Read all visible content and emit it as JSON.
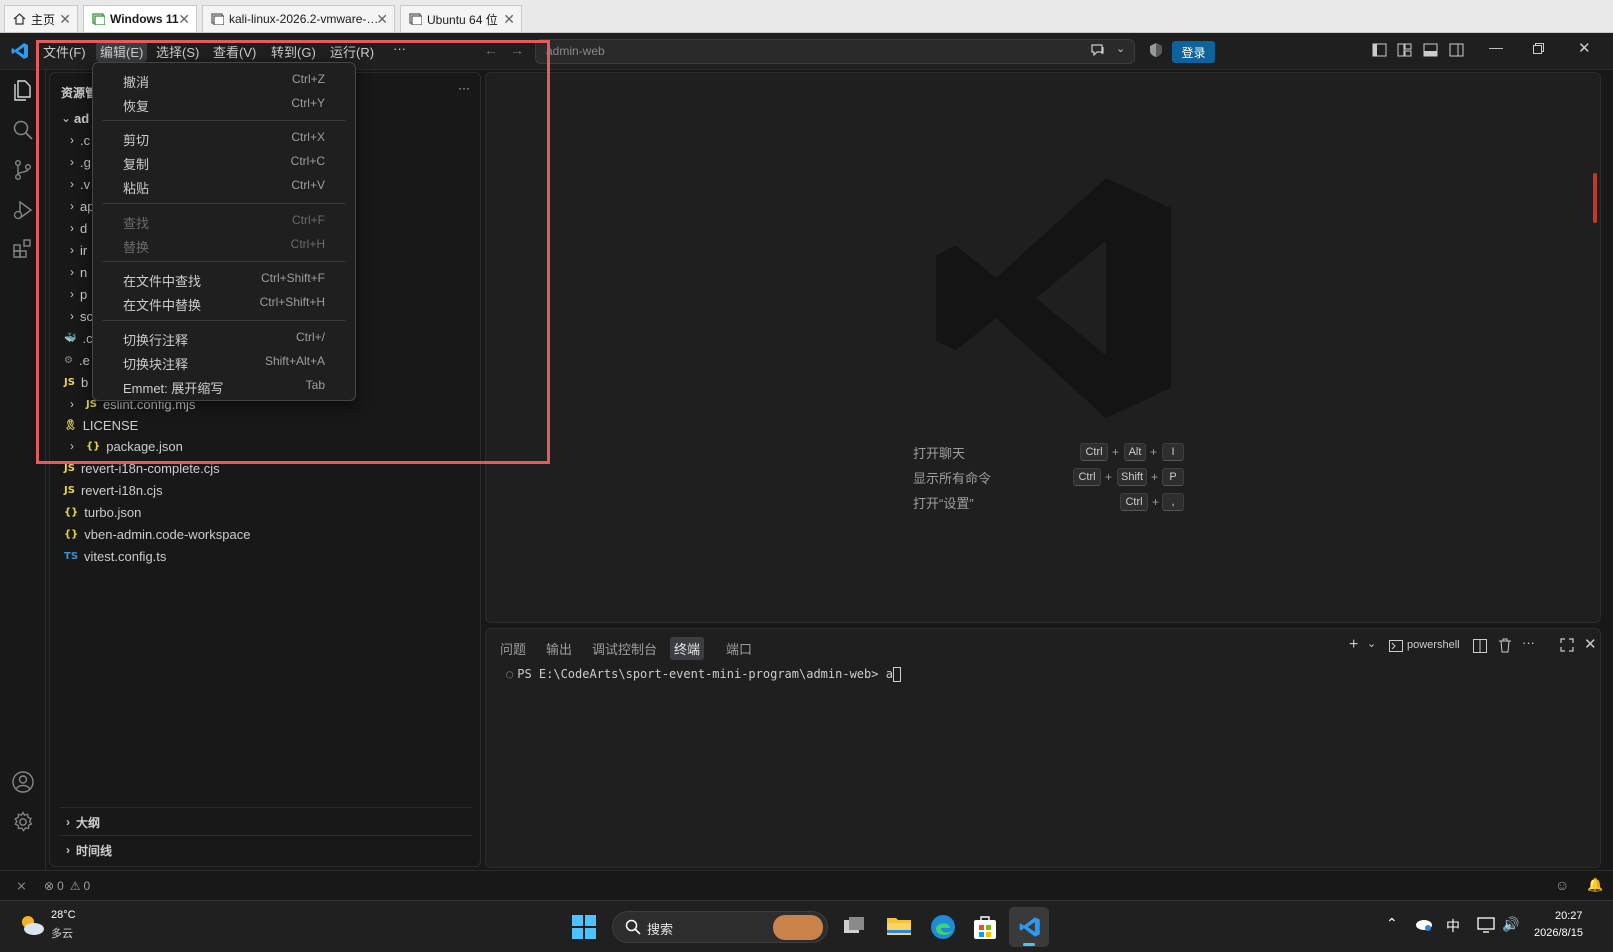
{
  "vm_tabs": [
    {
      "label": "主页",
      "icon": "home-icon"
    },
    {
      "label": "Windows 11",
      "icon": "vm-icon",
      "active": true
    },
    {
      "label": "kali-linux-2026.2-vmware-am...",
      "icon": "vm-icon"
    },
    {
      "label": "Ubuntu 64 位",
      "icon": "vm-icon"
    }
  ],
  "menubar": {
    "items": [
      "文件(F)",
      "编辑(E)",
      "选择(S)",
      "查看(V)",
      "转到(G)",
      "运行(R)",
      "···"
    ],
    "active": "编辑(E)"
  },
  "titlebar": {
    "search_text": "admin-web",
    "login_label": "登录"
  },
  "edit_menu": {
    "items": [
      {
        "label": "撤消",
        "shortcut": "Ctrl+Z"
      },
      {
        "label": "恢复",
        "shortcut": "Ctrl+Y"
      },
      {
        "label": "剪切",
        "shortcut": "Ctrl+X"
      },
      {
        "label": "复制",
        "shortcut": "Ctrl+C"
      },
      {
        "label": "粘贴",
        "shortcut": "Ctrl+V"
      },
      {
        "label": "查找",
        "shortcut": "Ctrl+F",
        "disabled": true
      },
      {
        "label": "替换",
        "shortcut": "Ctrl+H",
        "disabled": true
      },
      {
        "label": "在文件中查找",
        "shortcut": "Ctrl+Shift+F"
      },
      {
        "label": "在文件中替换",
        "shortcut": "Ctrl+Shift+H"
      },
      {
        "label": "切换行注释",
        "shortcut": "Ctrl+/"
      },
      {
        "label": "切换块注释",
        "shortcut": "Shift+Alt+A"
      },
      {
        "label": "Emmet: 展开缩写",
        "shortcut": "Tab"
      }
    ]
  },
  "explorer": {
    "title": "资源管",
    "more": "···",
    "root": "ad",
    "partial_rows": [
      ".c",
      ".g",
      ".v",
      "ap",
      "d",
      "ir",
      "n",
      "p",
      "sc",
      ".c",
      ".e",
      "b"
    ],
    "files": [
      {
        "name": "eslint.config.mjs",
        "icon": "JS",
        "folder": true
      },
      {
        "name": "LICENSE",
        "icon": "license"
      },
      {
        "name": "package.json",
        "icon": "{}",
        "folder": true
      },
      {
        "name": "revert-i18n-complete.cjs",
        "icon": "JS"
      },
      {
        "name": "revert-i18n.cjs",
        "icon": "JS"
      },
      {
        "name": "turbo.json",
        "icon": "{}"
      },
      {
        "name": "vben-admin.code-workspace",
        "icon": "{}"
      },
      {
        "name": "vitest.config.ts",
        "icon": "TS"
      }
    ],
    "outline_label": "大纲",
    "timeline_label": "时间线"
  },
  "welcome": {
    "shortcuts": [
      {
        "label": "打开聊天",
        "keys": [
          "Ctrl",
          "Alt",
          "I"
        ]
      },
      {
        "label": "显示所有命令",
        "keys": [
          "Ctrl",
          "Shift",
          "P"
        ]
      },
      {
        "label": "打开“设置”",
        "keys": [
          "Ctrl",
          ","
        ]
      }
    ]
  },
  "panel": {
    "tabs": [
      "问题",
      "输出",
      "调试控制台",
      "终端",
      "端口"
    ],
    "active_tab": "终端",
    "shell": "powershell",
    "prompt": "PS E:\\CodeArts\\sport-event-mini-program\\admin-web> ",
    "input": "a"
  },
  "statusbar": {
    "errors": "0",
    "warnings": "0"
  },
  "taskbar": {
    "weather_temp": "28°C",
    "weather_desc": "多云",
    "search_label": "搜索",
    "ime": "中",
    "time": "20:27",
    "date": "2026/8/15"
  },
  "colors": {
    "accent": "#0e639c",
    "annotation": "#e35b5b",
    "editor_bg": "#1f1f1f"
  }
}
